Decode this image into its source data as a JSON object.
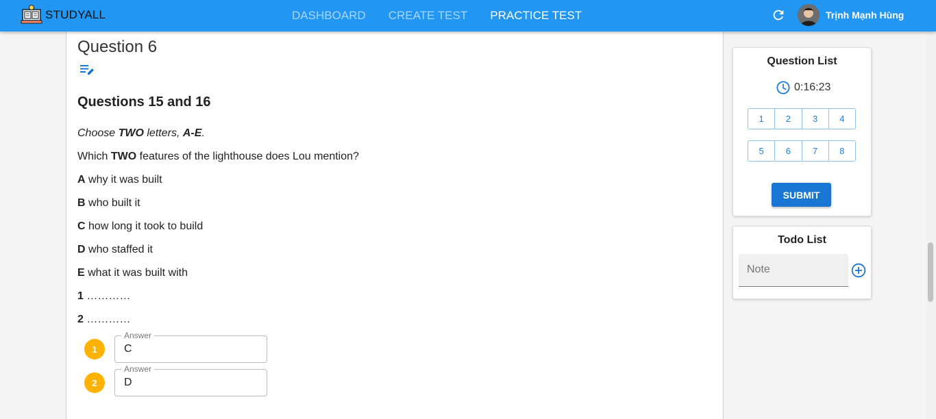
{
  "app": {
    "brand": "STUDYALL",
    "brand_color": "#2196f3"
  },
  "nav": [
    {
      "label": "DASHBOARD",
      "active": false
    },
    {
      "label": "CREATE TEST",
      "active": false
    },
    {
      "label": "PRACTICE TEST",
      "active": true
    }
  ],
  "user": {
    "name": "Trịnh Mạnh Hùng",
    "avatar_icon": "avatar"
  },
  "icons": {
    "refresh": "refresh-icon",
    "edit": "edit-note-icon",
    "timer": "clock-icon",
    "add": "add-circle-icon"
  },
  "question": {
    "title": "Question 6",
    "heading": "Questions 15 and 16",
    "instruction": {
      "pre": "Choose ",
      "bold1": "TWO",
      "mid": " letters, ",
      "bold2": "A-E",
      "post": "."
    },
    "prompt": {
      "pre": "Which ",
      "bold": "TWO",
      "post": " features of the lighthouse does Lou mention?"
    },
    "options": [
      {
        "letter": "A",
        "text": "why it was built"
      },
      {
        "letter": "B",
        "text": "who built it"
      },
      {
        "letter": "C",
        "text": "how long it took to build"
      },
      {
        "letter": "D",
        "text": "who staffed it"
      },
      {
        "letter": "E",
        "text": "what it was built with"
      }
    ],
    "blanks": [
      {
        "num": "1",
        "dots": "…………"
      },
      {
        "num": "2",
        "dots": "…………"
      }
    ],
    "answers": [
      {
        "step": "1",
        "legend": "Answer",
        "value": "C"
      },
      {
        "step": "2",
        "legend": "Answer",
        "value": "D"
      }
    ],
    "answer_badge_color": "#ffb300"
  },
  "question_list": {
    "title": "Question List",
    "timer": "0:16:23",
    "rows": [
      [
        "1",
        "2",
        "3",
        "4"
      ],
      [
        "5",
        "6",
        "7",
        "8"
      ]
    ],
    "submit_label": "SUBMIT",
    "submit_color": "#1976d2"
  },
  "todo": {
    "title": "Todo List",
    "placeholder": "Note"
  }
}
